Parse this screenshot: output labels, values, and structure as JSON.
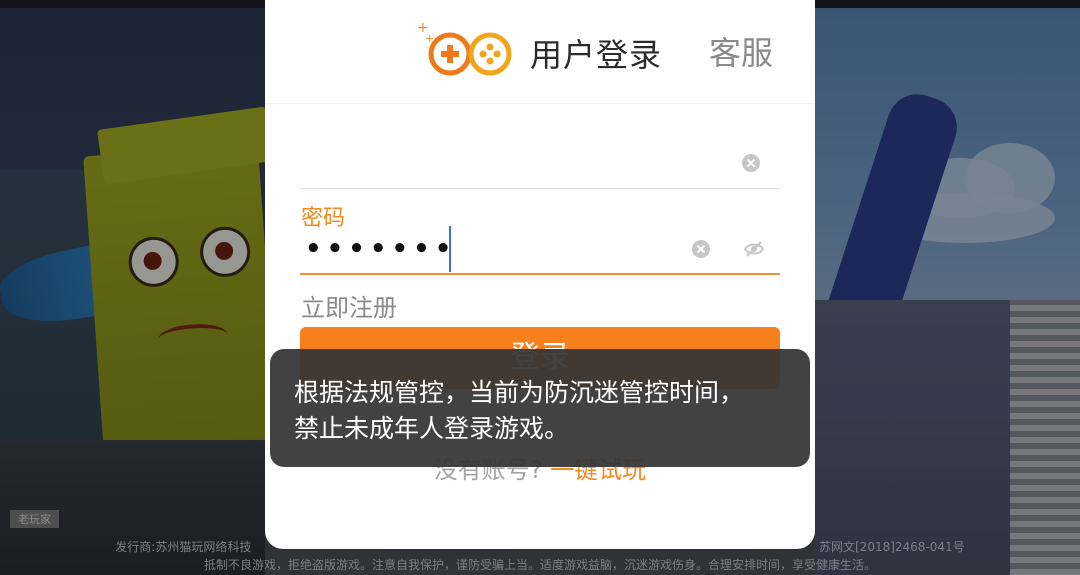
{
  "header": {
    "title": "用户登录",
    "service_label": "客服"
  },
  "username_field": {
    "value": ""
  },
  "password_field": {
    "label": "密码",
    "value": "•••••••"
  },
  "register_link": "立即注册",
  "login_button": "登录",
  "trial": {
    "no_account_text": "没有账号?",
    "trial_link": "一键试玩"
  },
  "toast": {
    "line1": "根据法规管控，当前为防沉迷管控时间，",
    "line2": "禁止未成年人登录游戏。"
  },
  "footer": {
    "publisher": "发行商:苏州猫玩网络科技",
    "license": "苏网文[2018]2468-041号",
    "health_notice": "抵制不良游戏，拒绝盗版游戏。注意自我保护，谨防受骗上当。适度游戏益脑，沉迷游戏伤身。合理安排时间，享受健康生活。"
  },
  "player_tag": "老玩家",
  "colors": {
    "accent": "#f7801d",
    "label_orange": "#f0891e",
    "toast_bg": "#343434"
  },
  "icons": {
    "logo": "gamepad-plus-logo",
    "clear": "clear-x-icon",
    "visibility": "eye-hidden-icon"
  }
}
